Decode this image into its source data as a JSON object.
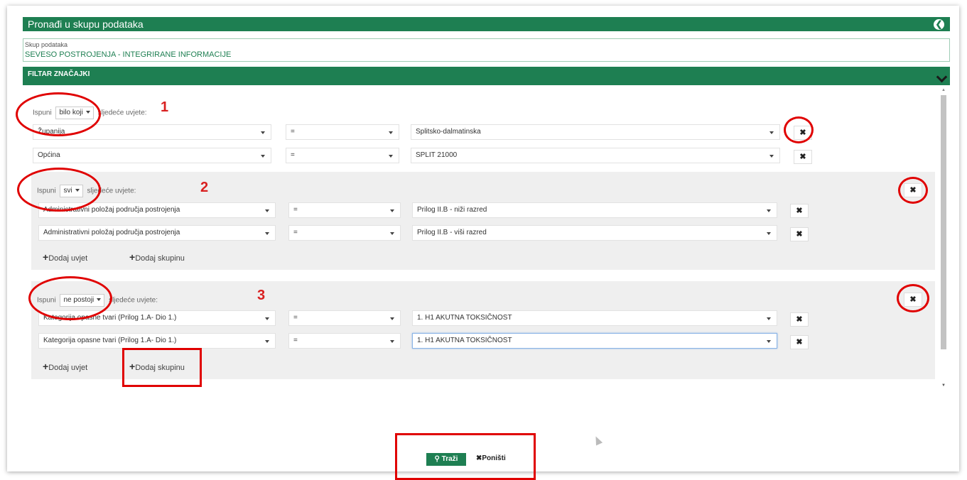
{
  "header": {
    "title": "Pronađi u skupu podataka"
  },
  "dataset": {
    "label": "Skup podataka",
    "value": "SEVESO POSTROJENJA - INTEGRIRANE INFORMACIJE"
  },
  "filter": {
    "title": "FILTAR ZNAČAJKI"
  },
  "groups": [
    {
      "prefix": "Ispuni",
      "mode": "bilo koji",
      "suffix": "sljedeće uvjete:",
      "annotation": "1",
      "rows": [
        {
          "field": "Županija",
          "operator": "=",
          "value": "Splitsko-dalmatinska"
        },
        {
          "field": "Općina",
          "operator": "=",
          "value": "SPLIT 21000"
        }
      ]
    },
    {
      "prefix": "Ispuni",
      "mode": "svi",
      "suffix": "sljedeće uvjete:",
      "annotation": "2",
      "rows": [
        {
          "field": "Administrativni položaj područja postrojenja",
          "operator": "=",
          "value": "Prilog II.B - niži razred"
        },
        {
          "field": "Administrativni položaj područja postrojenja",
          "operator": "=",
          "value": "Prilog II.B - viši razred"
        }
      ],
      "add_condition": "Dodaj uvjet",
      "add_group": "Dodaj skupinu"
    },
    {
      "prefix": "Ispuni",
      "mode": "ne postoji",
      "suffix": "sljedeće uvjete:",
      "annotation": "3",
      "rows": [
        {
          "field": "Kategorija opasne tvari (Prilog 1.A- Dio 1.)",
          "operator": "=",
          "value": "1. H1 AKUTNA TOKSIČNOST"
        },
        {
          "field": "Kategorija opasne tvari (Prilog 1.A- Dio 1.)",
          "operator": "=",
          "value": "1. H1 AKUTNA TOKSIČNOST"
        }
      ],
      "add_condition": "Dodaj uvjet",
      "add_group": "Dodaj skupinu"
    }
  ],
  "actions": {
    "search": "Traži",
    "reset": "Poništi"
  },
  "icons": {
    "remove": "close-icon",
    "add": "plus-icon",
    "search": "search-icon",
    "back": "back-icon",
    "expand": "chevron-down-icon"
  },
  "colors": {
    "brand": "#1e7f52",
    "annotation": "#e00000",
    "group_bg": "#efefef"
  }
}
